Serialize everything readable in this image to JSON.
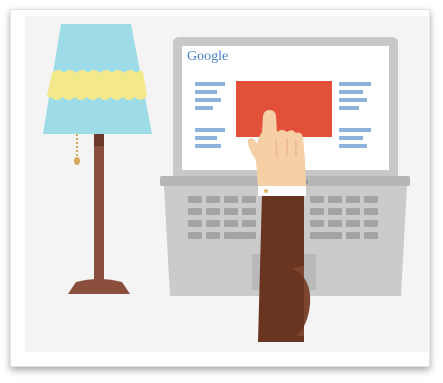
{
  "screen": {
    "logo_text": "Google"
  },
  "colors": {
    "frame_background": "#ffffff",
    "panel_background": "#f4f4f4",
    "lamp_shade": "#9ddbe6",
    "lamp_shade_band": "#f4e98a",
    "lamp_pole": "#8a4e3d",
    "laptop_body": "#c8c8c8",
    "laptop_screen": "#ffffff",
    "result_lines": "#8fb1dd",
    "ad_block": "#e2503a",
    "sleeve": "#6a3520",
    "hand": "#f6cfa6",
    "keys": "#a3a3a3"
  },
  "icons": [
    "lamp-icon",
    "laptop-icon",
    "hand-icon"
  ]
}
